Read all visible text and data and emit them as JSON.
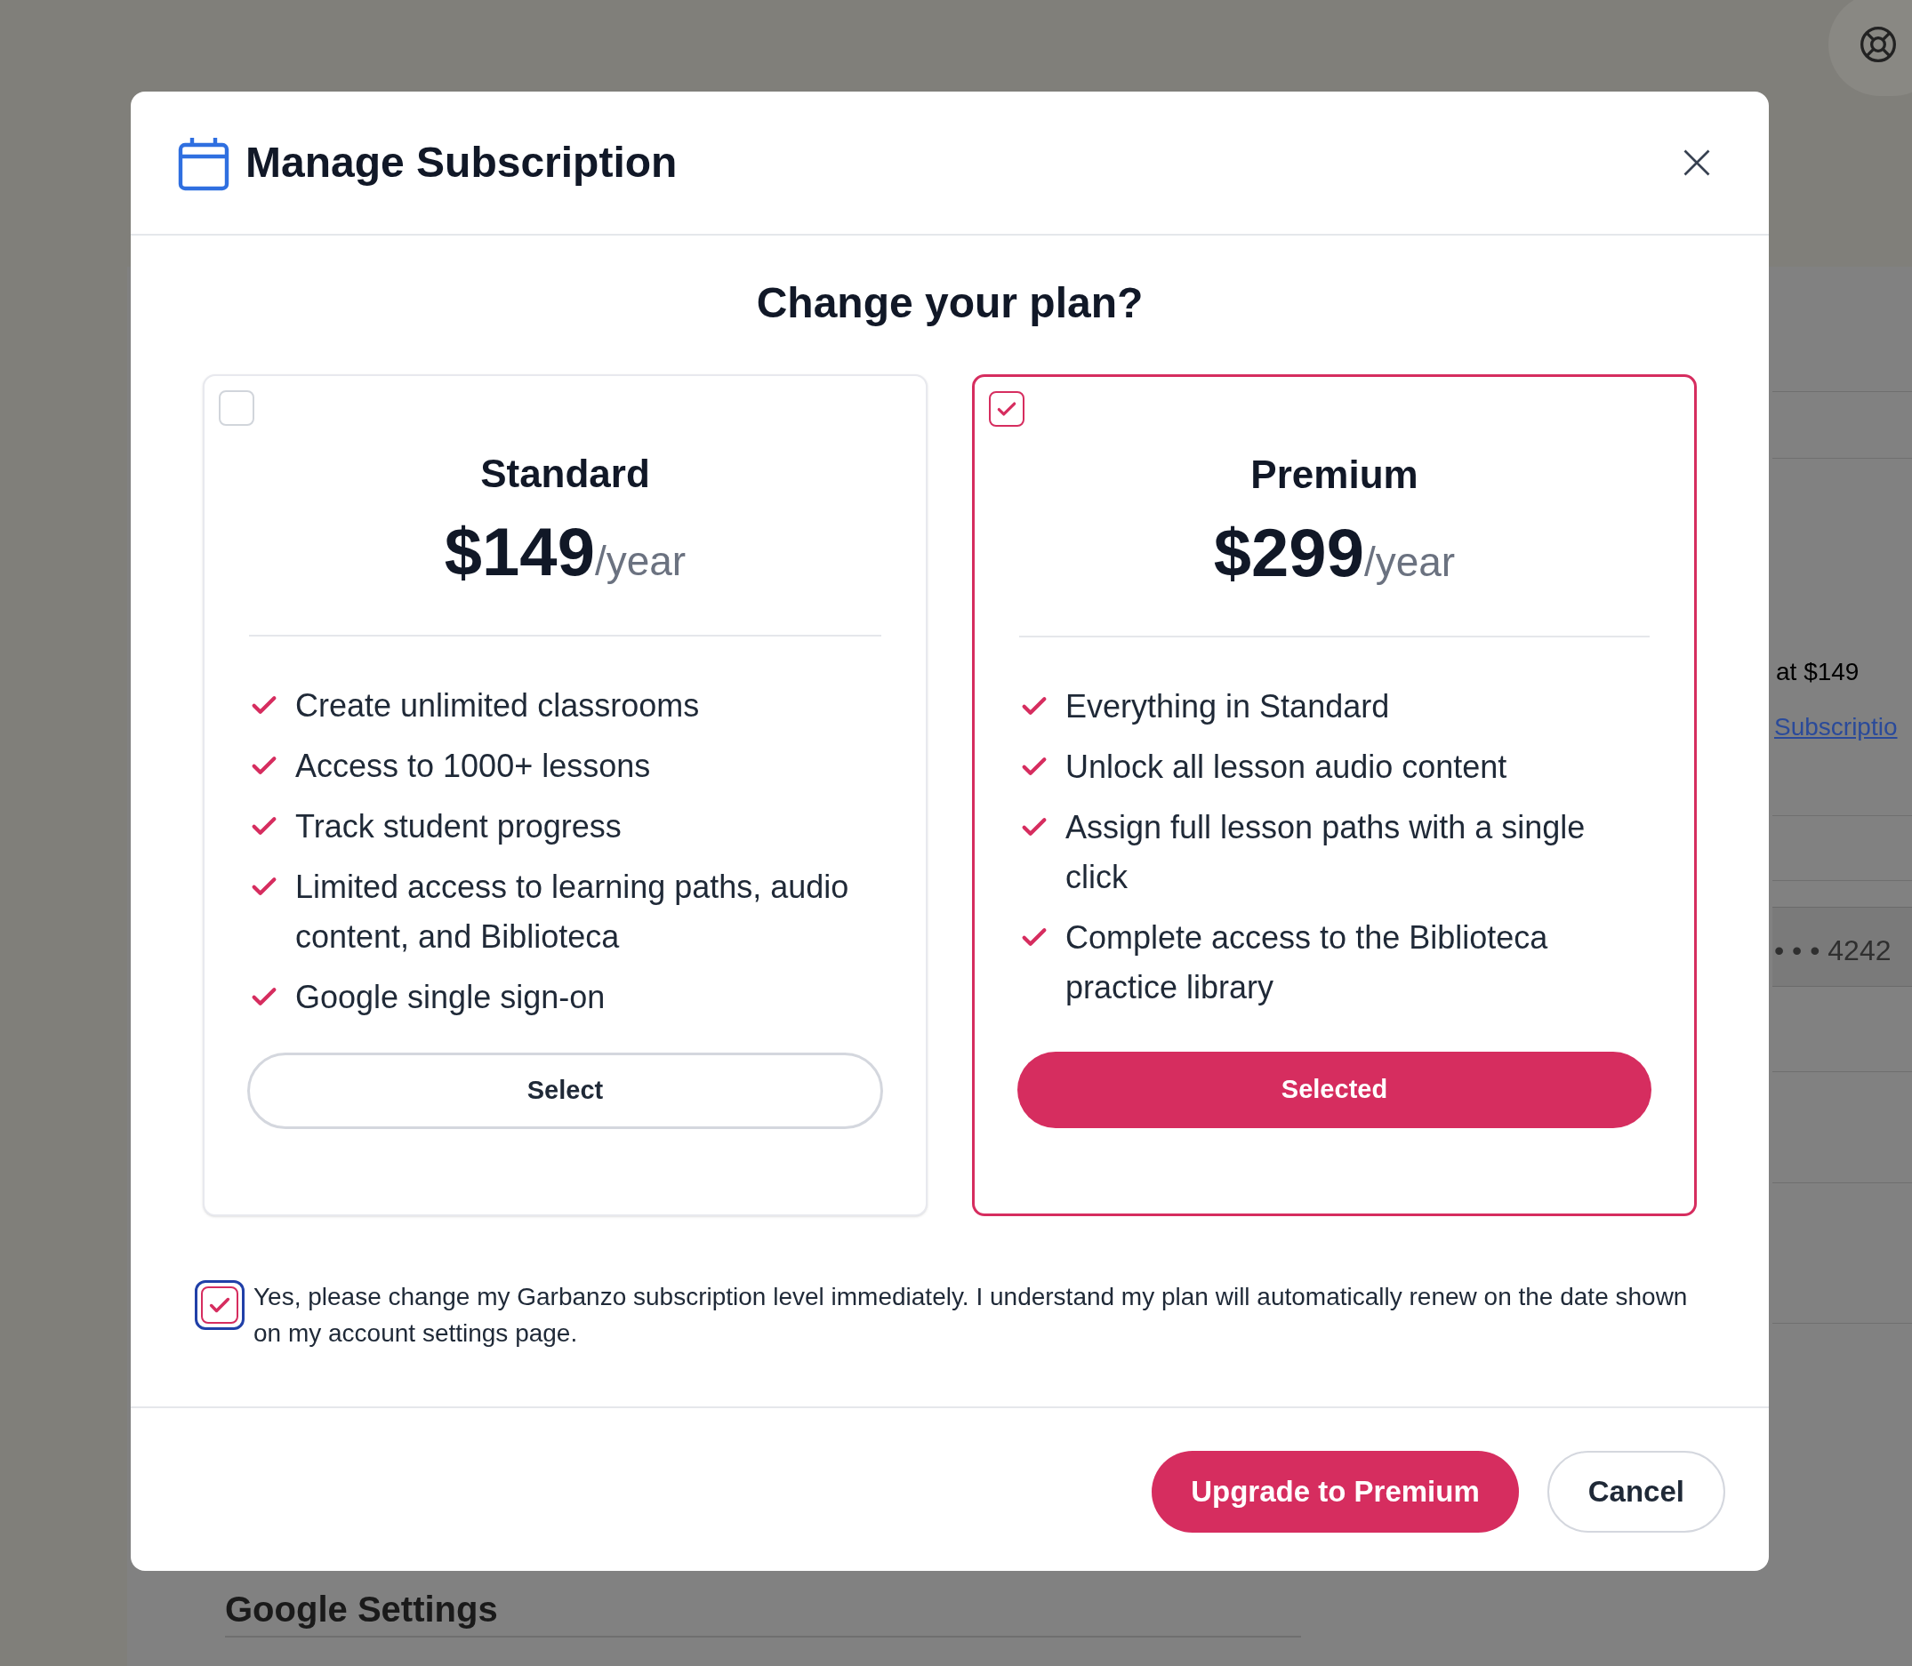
{
  "background": {
    "price_note": "at $149",
    "link": "Subscriptio",
    "card_number": "• • • 4242",
    "section_title": "Google Settings"
  },
  "dialog": {
    "title": "Manage Subscription",
    "heading": "Change your plan?",
    "plans": [
      {
        "name": "Standard",
        "price": "$149",
        "period": "/year",
        "selected": false,
        "button": "Select",
        "features": [
          "Create unlimited classrooms",
          "Access to 1000+ lessons",
          "Track student progress",
          "Limited access to learning paths, audio content, and Biblioteca",
          "Google single sign-on"
        ]
      },
      {
        "name": "Premium",
        "price": "$299",
        "period": "/year",
        "selected": true,
        "button": "Selected",
        "features": [
          "Everything in Standard",
          "Unlock all lesson audio content",
          "Assign full lesson paths with a single click",
          "Complete access to the Biblioteca practice library"
        ]
      }
    ],
    "confirm": {
      "text": "Yes, please change my Garbanzo subscription level immediately. I understand my plan will automatically renew on the date shown on my account settings page.",
      "checked": true
    },
    "actions": [
      {
        "label": "Upgrade to Premium",
        "kind": "primary"
      },
      {
        "label": "Cancel",
        "kind": "secondary"
      }
    ]
  }
}
